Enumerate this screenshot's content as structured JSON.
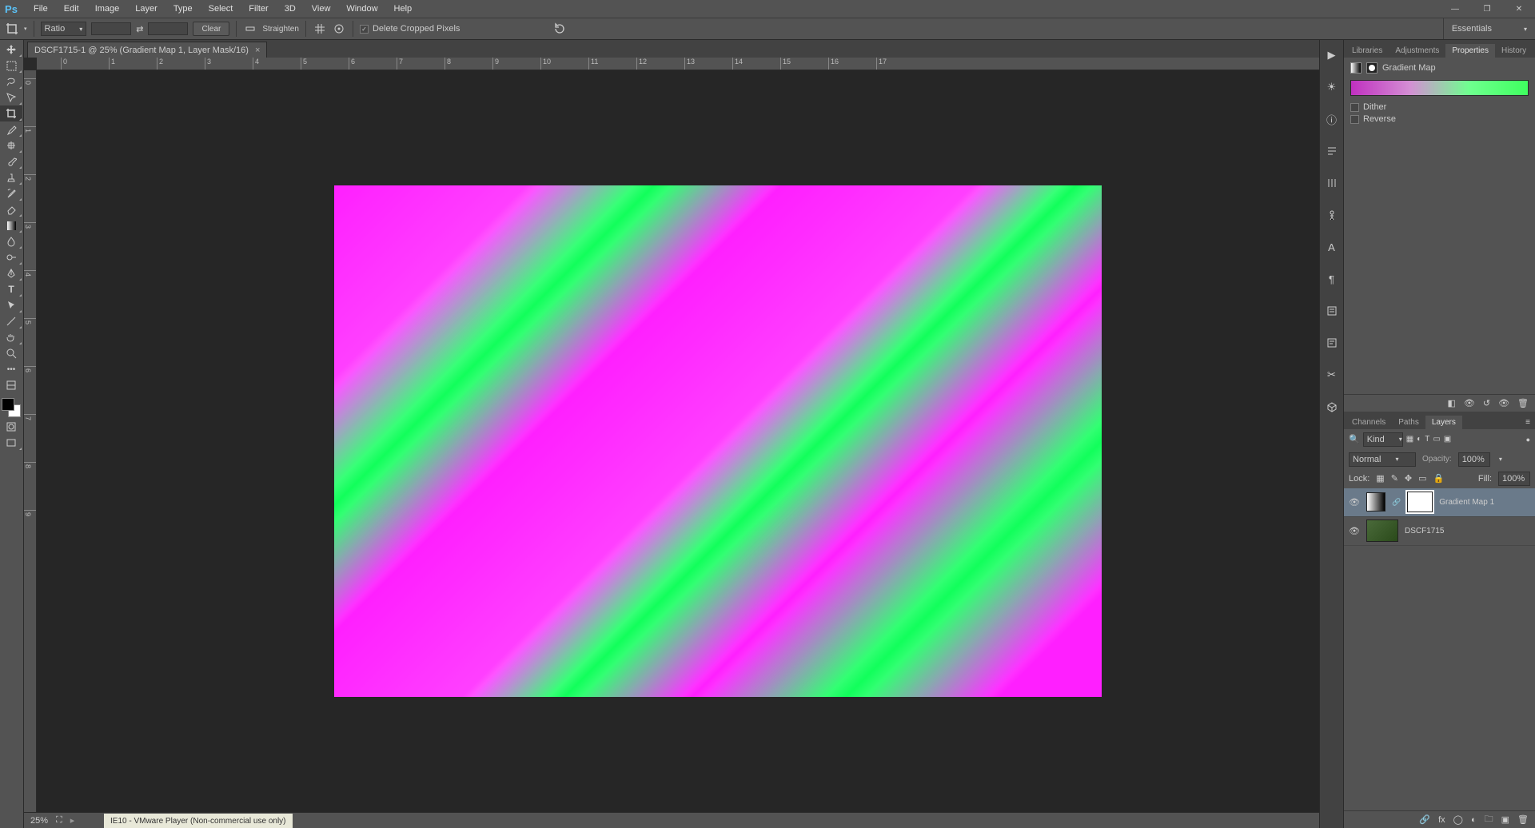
{
  "menu": {
    "items": [
      "File",
      "Edit",
      "Image",
      "Layer",
      "Type",
      "Select",
      "Filter",
      "3D",
      "View",
      "Window",
      "Help"
    ]
  },
  "optbar": {
    "ratio_label": "Ratio",
    "clear": "Clear",
    "straighten": "Straighten",
    "delete_cropped": "Delete Cropped Pixels"
  },
  "workspace": "Essentials",
  "doc": {
    "tab": "DSCF1715-1 @ 25% (Gradient Map 1, Layer Mask/16)",
    "zoom": "25%"
  },
  "ruler_h": [
    "0",
    "1",
    "2",
    "3",
    "4",
    "5",
    "6",
    "7",
    "8",
    "9",
    "10",
    "11",
    "12",
    "13",
    "14",
    "15",
    "16",
    "17"
  ],
  "ruler_v": [
    "0",
    "1",
    "2",
    "3",
    "4",
    "5",
    "6",
    "7",
    "8",
    "9"
  ],
  "panels_top": {
    "tabs": [
      "Libraries",
      "Adjustments",
      "Properties",
      "History"
    ],
    "active": 2
  },
  "properties": {
    "title": "Gradient Map",
    "dither": "Dither",
    "reverse": "Reverse"
  },
  "panels_bot": {
    "tabs": [
      "Channels",
      "Paths",
      "Layers"
    ],
    "active": 2
  },
  "layers": {
    "filter_label": "Kind",
    "blend_mode": "Normal",
    "opacity_label": "Opacity:",
    "opacity_val": "100%",
    "lock_label": "Lock:",
    "fill_label": "Fill:",
    "fill_val": "100%",
    "rows": [
      {
        "name": "Gradient Map 1"
      },
      {
        "name": "DSCF1715"
      }
    ]
  },
  "player": "IE10 - VMware Player (Non-commercial use only)"
}
